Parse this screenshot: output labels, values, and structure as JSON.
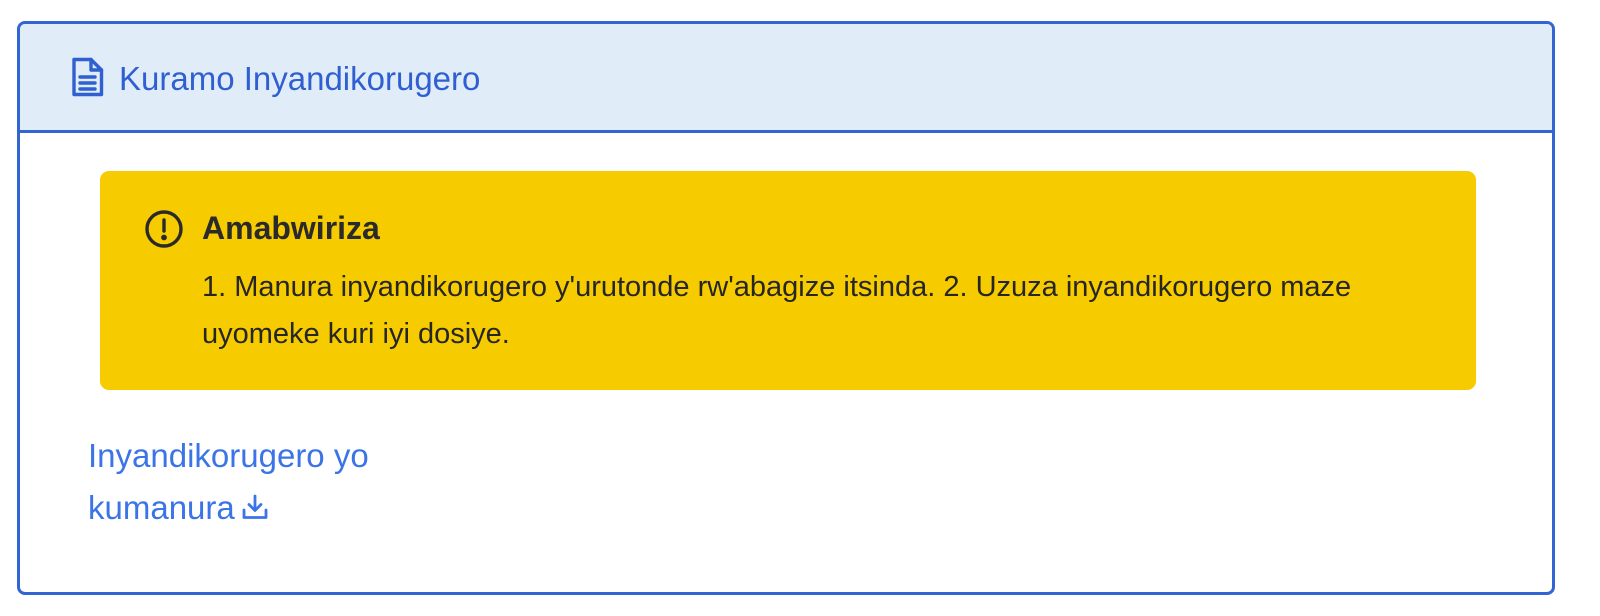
{
  "panel": {
    "header": {
      "icon": "file-text-icon",
      "title": "Kuramo Inyandikorugero"
    },
    "alert": {
      "icon": "alert-circle-icon",
      "title": "Amabwiriza",
      "body": "1. Manura inyandikorugero y'urutonde rw'abagize itsinda. 2. Uzuza inyandikorugero maze uyomeke kuri iyi dosiye."
    },
    "download": {
      "label": "Inyandikorugero yo kumanura",
      "icon": "download-icon"
    }
  },
  "colors": {
    "accent": "#3264d2",
    "header_bg": "#e1ecf9",
    "alert_bg": "#f6cb00",
    "link": "#3b74e6"
  }
}
